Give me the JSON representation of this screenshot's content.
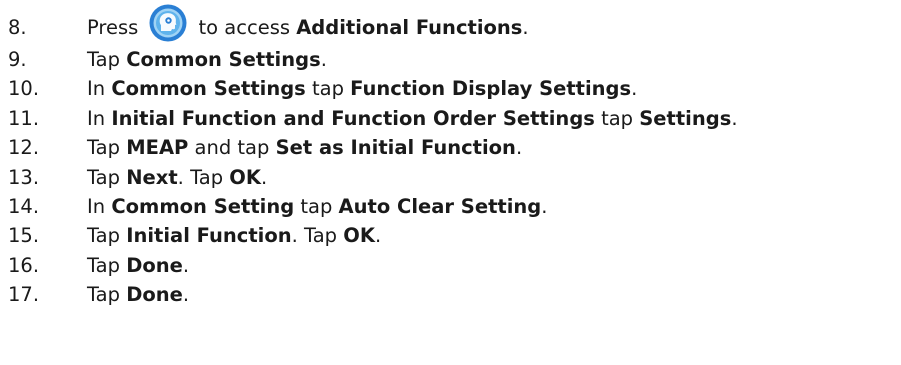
{
  "colors": {
    "text": "#1a1a1a",
    "icon_outer": "#2a7fd4",
    "icon_inner": "#9fd3f5",
    "icon_glyph": "#ffffff"
  },
  "steps": [
    {
      "number": "8.",
      "parts": [
        {
          "t": "Press ",
          "b": false
        },
        {
          "icon": "additional-functions-icon"
        },
        {
          "t": "to access ",
          "b": false
        },
        {
          "t": "Additional Functions",
          "b": true
        },
        {
          "t": ".",
          "b": false
        }
      ]
    },
    {
      "number": "9.",
      "parts": [
        {
          "t": "Tap ",
          "b": false
        },
        {
          "t": "Common Settings",
          "b": true
        },
        {
          "t": ".",
          "b": false
        }
      ]
    },
    {
      "number": "10.",
      "parts": [
        {
          "t": "In ",
          "b": false
        },
        {
          "t": "Common Settings",
          "b": true
        },
        {
          "t": " tap ",
          "b": false
        },
        {
          "t": "Function Display Settings",
          "b": true
        },
        {
          "t": ".",
          "b": false
        }
      ]
    },
    {
      "number": "11.",
      "parts": [
        {
          "t": "In ",
          "b": false
        },
        {
          "t": "Initial Function and Function Order Settings",
          "b": true
        },
        {
          "t": " tap ",
          "b": false
        },
        {
          "t": "Settings",
          "b": true
        },
        {
          "t": ".",
          "b": false
        }
      ]
    },
    {
      "number": "12.",
      "parts": [
        {
          "t": "Tap ",
          "b": false
        },
        {
          "t": "MEAP",
          "b": true
        },
        {
          "t": " and tap ",
          "b": false
        },
        {
          "t": "Set as Initial Function",
          "b": true
        },
        {
          "t": ".",
          "b": false
        }
      ]
    },
    {
      "number": "13.",
      "parts": [
        {
          "t": "Tap ",
          "b": false
        },
        {
          "t": "Next",
          "b": true
        },
        {
          "t": ". Tap ",
          "b": false
        },
        {
          "t": "OK",
          "b": true
        },
        {
          "t": ".",
          "b": false
        }
      ]
    },
    {
      "number": "14.",
      "parts": [
        {
          "t": "In ",
          "b": false
        },
        {
          "t": "Common Setting",
          "b": true
        },
        {
          "t": " tap ",
          "b": false
        },
        {
          "t": "Auto Clear Setting",
          "b": true
        },
        {
          "t": ".",
          "b": false
        }
      ]
    },
    {
      "number": "15.",
      "parts": [
        {
          "t": "Tap ",
          "b": false
        },
        {
          "t": "Initial Function",
          "b": true
        },
        {
          "t": ". Tap ",
          "b": false
        },
        {
          "t": "OK",
          "b": true
        },
        {
          "t": ".",
          "b": false
        }
      ]
    },
    {
      "number": "16.",
      "parts": [
        {
          "t": "Tap ",
          "b": false
        },
        {
          "t": "Done",
          "b": true
        },
        {
          "t": ".",
          "b": false
        }
      ]
    },
    {
      "number": "17.",
      "parts": [
        {
          "t": "Tap ",
          "b": false
        },
        {
          "t": "Done",
          "b": true
        },
        {
          "t": ".",
          "b": false
        }
      ]
    }
  ]
}
